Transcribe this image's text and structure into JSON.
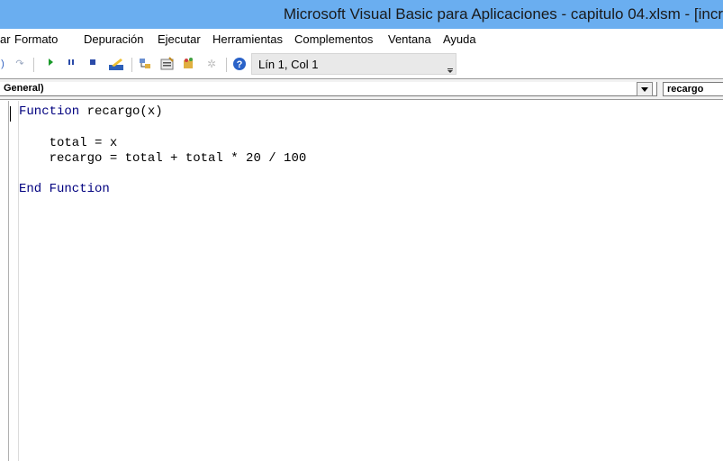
{
  "window": {
    "title": "Microsoft Visual Basic para Aplicaciones - capitulo 04.xlsm - [incr"
  },
  "menu": [
    "ar",
    "Formato",
    "Depuración",
    "Ejecutar",
    "Herramientas",
    "Complementos",
    "Ventana",
    "Ayuda"
  ],
  "toolbar": {
    "cursor_position": "Lín 1, Col 1",
    "icons": [
      "redo-icon",
      "run-icon",
      "break-icon",
      "reset-icon",
      "design-mode-icon",
      "project-explorer-icon",
      "properties-icon",
      "object-browser-icon",
      "toolbox-icon",
      "help-icon"
    ]
  },
  "combos": {
    "object": "General)",
    "procedure": "recargo"
  },
  "code": {
    "line1_kw": "Function",
    "line1_rest": " recargo(x)",
    "line2": "    total = x",
    "line3": "    recargo = total + total * 20 / 100",
    "line4_kw": "End Function"
  },
  "colors": {
    "titlebar": "#6aaef0",
    "keyword": "#00007f"
  }
}
